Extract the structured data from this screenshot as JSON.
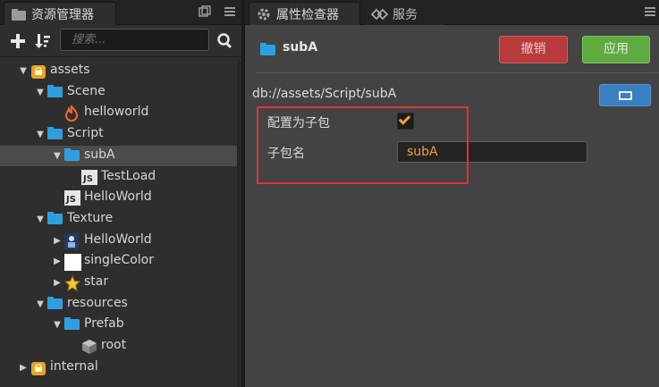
{
  "left_panel": {
    "tab_title": "资源管理器",
    "tab_icon": "folder-panel-icon",
    "search_placeholder": "搜索...",
    "tree": [
      {
        "label": "assets",
        "icon": "asset-db-icon",
        "depth": 0,
        "expanded": true
      },
      {
        "label": "Scene",
        "icon": "folder-icon",
        "depth": 1,
        "expanded": true
      },
      {
        "label": "helloworld",
        "icon": "fire-icon",
        "depth": 2
      },
      {
        "label": "Script",
        "icon": "folder-icon",
        "depth": 1,
        "expanded": true
      },
      {
        "label": "subA",
        "icon": "folder-icon",
        "depth": 2,
        "expanded": true,
        "selected": true
      },
      {
        "label": "TestLoad",
        "icon": "js-icon",
        "depth": 3
      },
      {
        "label": "HelloWorld",
        "icon": "js-icon",
        "depth": 2
      },
      {
        "label": "Texture",
        "icon": "folder-icon",
        "depth": 1,
        "expanded": true
      },
      {
        "label": "HelloWorld",
        "icon": "image-icon",
        "depth": 2,
        "expanded": false
      },
      {
        "label": "singleColor",
        "icon": "white-square-icon",
        "depth": 2,
        "expanded": false
      },
      {
        "label": "star",
        "icon": "star-icon",
        "depth": 2,
        "expanded": false
      },
      {
        "label": "resources",
        "icon": "folder-icon",
        "depth": 1,
        "expanded": true
      },
      {
        "label": "Prefab",
        "icon": "folder-icon",
        "depth": 2,
        "expanded": true
      },
      {
        "label": "root",
        "icon": "cube-icon",
        "depth": 3
      },
      {
        "label": "internal",
        "icon": "asset-db-icon",
        "depth": 0,
        "expanded": false
      }
    ]
  },
  "right_panel": {
    "tabs": [
      {
        "label": "属性检查器",
        "icon": "gear-icon",
        "active": true
      },
      {
        "label": "服务",
        "icon": "services-icon",
        "active": false
      }
    ],
    "title": "subA",
    "revert_label": "撤销",
    "apply_label": "应用",
    "path": "db://assets/Script/subA",
    "props": {
      "subpackage_label": "配置为子包",
      "subpackage_checked": true,
      "subpackage_name_label": "子包名",
      "subpackage_name_value": "subA"
    }
  },
  "colors": {
    "accent_folder": "#2f9ee0",
    "revert_red": "#b83b3b",
    "apply_green": "#5fab42",
    "highlight_red": "#e0313a",
    "value_orange": "#f0a22b"
  }
}
